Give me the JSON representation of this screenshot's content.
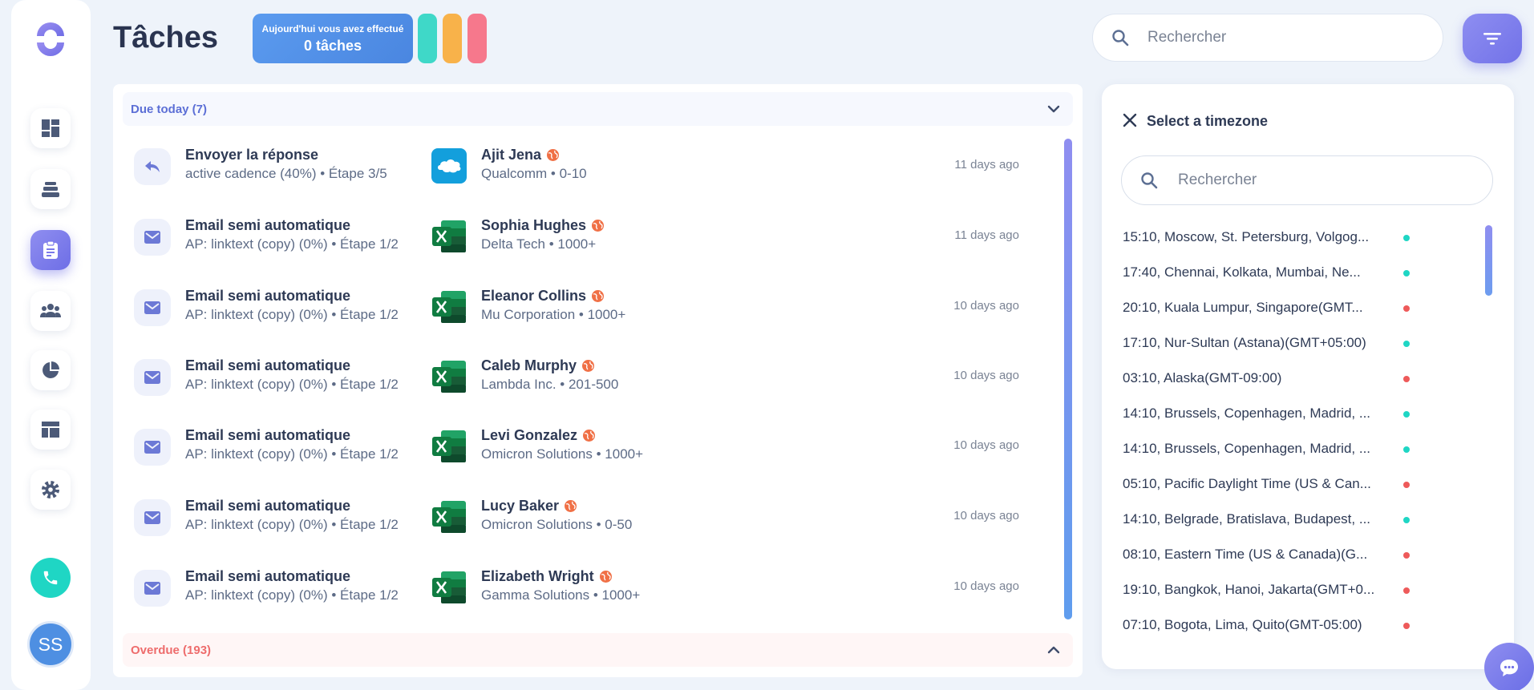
{
  "header": {
    "title": "Tâches",
    "today_line1": "Aujourd'hui vous avez effectué",
    "today_line2": "0 tâches",
    "search_placeholder": "Rechercher"
  },
  "sidebar": {
    "avatar_initials": "SS",
    "items": [
      {
        "icon": "dashboard-icon"
      },
      {
        "icon": "layers-icon"
      },
      {
        "icon": "clipboard-icon",
        "active": true
      },
      {
        "icon": "people-icon"
      },
      {
        "icon": "pie-chart-icon"
      },
      {
        "icon": "layout-icon"
      },
      {
        "icon": "gear-icon"
      }
    ]
  },
  "tasks": {
    "due_label": "Due today (7)",
    "overdue_label": "Overdue (193)",
    "items": [
      {
        "type": "reply",
        "title": "Envoyer la réponse",
        "sub": "active cadence (40%) • Étape 3/5",
        "source": "salesforce",
        "name": "Ajit Jena",
        "company": "Qualcomm • 0-10",
        "time": "11 days ago"
      },
      {
        "type": "email",
        "title": "Email semi automatique",
        "sub": "AP: linktext (copy) (0%) • Étape 1/2",
        "source": "excel",
        "name": "Sophia Hughes",
        "company": "Delta Tech • 1000+",
        "time": "11 days ago"
      },
      {
        "type": "email",
        "title": "Email semi automatique",
        "sub": "AP: linktext (copy) (0%) • Étape 1/2",
        "source": "excel",
        "name": "Eleanor Collins",
        "company": "Mu Corporation • 1000+",
        "time": "10 days ago"
      },
      {
        "type": "email",
        "title": "Email semi automatique",
        "sub": "AP: linktext (copy) (0%) • Étape 1/2",
        "source": "excel",
        "name": "Caleb Murphy",
        "company": "Lambda Inc. • 201-500",
        "time": "10 days ago"
      },
      {
        "type": "email",
        "title": "Email semi automatique",
        "sub": "AP: linktext (copy) (0%) • Étape 1/2",
        "source": "excel",
        "name": "Levi Gonzalez",
        "company": "Omicron Solutions • 1000+",
        "time": "10 days ago"
      },
      {
        "type": "email",
        "title": "Email semi automatique",
        "sub": "AP: linktext (copy) (0%) • Étape 1/2",
        "source": "excel",
        "name": "Lucy Baker",
        "company": "Omicron Solutions • 0-50",
        "time": "10 days ago"
      },
      {
        "type": "email",
        "title": "Email semi automatique",
        "sub": "AP: linktext (copy) (0%) • Étape 1/2",
        "source": "excel",
        "name": "Elizabeth Wright",
        "company": "Gamma Solutions • 1000+",
        "time": "10 days ago"
      }
    ]
  },
  "timezone": {
    "title": "Select a timezone",
    "search_placeholder": "Rechercher",
    "items": [
      {
        "label": "15:10, Moscow, St. Petersburg, Volgog...",
        "status": "#1fd6c4"
      },
      {
        "label": "17:40, Chennai, Kolkata, Mumbai, Ne...",
        "status": "#1fd6c4"
      },
      {
        "label": "20:10, Kuala Lumpur, Singapore(GMT...",
        "status": "#ee5a5a"
      },
      {
        "label": "17:10, Nur-Sultan (Astana)(GMT+05:00)",
        "status": "#1fd6c4"
      },
      {
        "label": "03:10, Alaska(GMT-09:00)",
        "status": "#ee5a5a"
      },
      {
        "label": "14:10, Brussels, Copenhagen, Madrid, ...",
        "status": "#1fd6c4"
      },
      {
        "label": "14:10, Brussels, Copenhagen, Madrid, ...",
        "status": "#1fd6c4"
      },
      {
        "label": "05:10, Pacific Daylight Time (US & Can...",
        "status": "#ee5a5a"
      },
      {
        "label": "14:10, Belgrade, Bratislava, Budapest, ...",
        "status": "#1fd6c4"
      },
      {
        "label": "08:10, Eastern Time (US & Canada)(G...",
        "status": "#ee5a5a"
      },
      {
        "label": "19:10, Bangkok, Hanoi, Jakarta(GMT+0...",
        "status": "#ee5a5a"
      },
      {
        "label": "07:10, Bogota, Lima, Quito(GMT-05:00)",
        "status": "#ee5a5a"
      }
    ]
  },
  "colors": {
    "accent": "#7272e8",
    "teal": "#3fd8c8",
    "orange": "#f8b24a",
    "pink": "#f6788c"
  }
}
